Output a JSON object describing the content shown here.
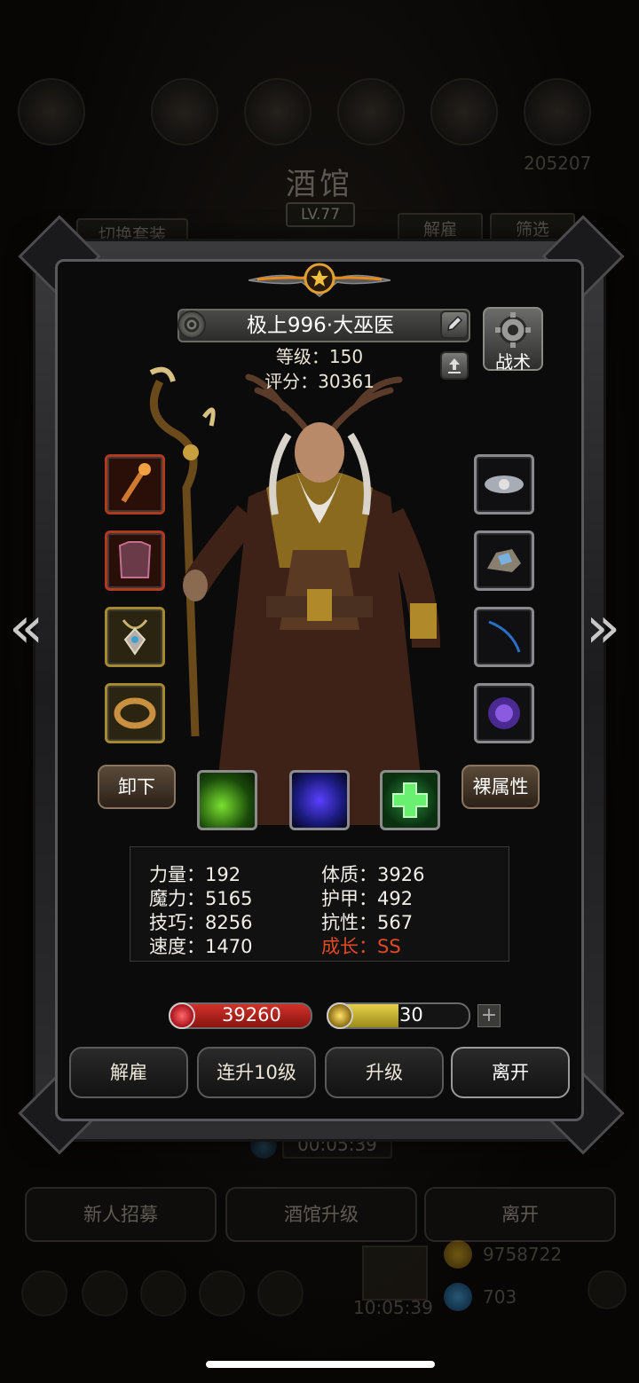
{
  "background": {
    "title": "酒馆",
    "level": "LV.77",
    "coins_top": "205207",
    "switch_outfit": "切换套装",
    "dismiss": "解雇",
    "filter": "筛选",
    "timer": "00:05:39",
    "recruit": "新人招募",
    "upgrade_tavern": "酒馆升级",
    "leave": "离开",
    "gold": "9758722",
    "gems": "703",
    "gift_timer": "10:05:39"
  },
  "hero": {
    "name": "极上996·大巫医",
    "level_line": "等级：150",
    "score_line": "评分：30361",
    "tactics": "战术",
    "unequip": "卸下",
    "naked_attr": "裸属性"
  },
  "stats": {
    "strength": "力量：192",
    "constitution": "体质：3926",
    "magic": "魔力：5165",
    "armor": "护甲：492",
    "skill": "技巧：8256",
    "resist": "抗性：567",
    "speed": "速度：1470",
    "growth": "成长：SS"
  },
  "bars": {
    "hp": "39260",
    "energy": "30",
    "energy_fill": 0.5,
    "plus": "+"
  },
  "actions": {
    "dismiss": "解雇",
    "level10": "连升10级",
    "levelup": "升级",
    "leave": "离开"
  },
  "nav": {
    "prev": "«",
    "next": "»"
  },
  "colors": {
    "growth": "#e14a24",
    "hp": "#d0322a",
    "energy": "#e5d24a"
  }
}
